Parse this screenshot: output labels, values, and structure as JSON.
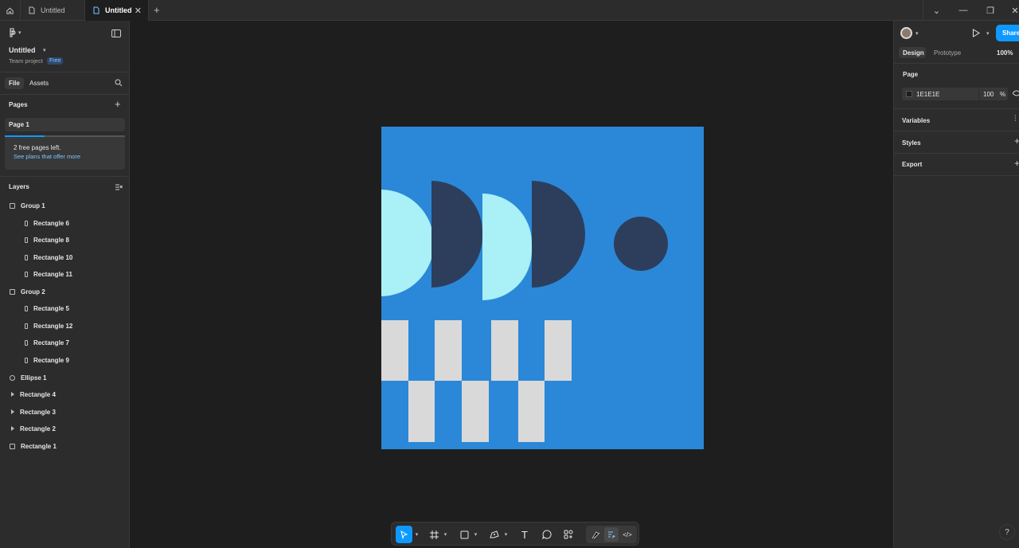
{
  "titlebar": {
    "tabs": [
      {
        "label": "Untitled"
      },
      {
        "label": "Untitled"
      }
    ]
  },
  "file": {
    "name": "Untitled",
    "project": "Team project",
    "plan_badge": "Free"
  },
  "left_tabs": {
    "file": "File",
    "assets": "Assets"
  },
  "pages": {
    "heading": "Pages",
    "items": [
      "Page 1"
    ],
    "upsell_title": "2 free pages left.",
    "upsell_link": "See plans that offer more"
  },
  "layers": {
    "heading": "Layers",
    "items": [
      {
        "name": "Group 1",
        "type": "group"
      },
      {
        "name": "Rectangle 6",
        "type": "rect"
      },
      {
        "name": "Rectangle 8",
        "type": "rect"
      },
      {
        "name": "Rectangle 10",
        "type": "rect"
      },
      {
        "name": "Rectangle 11",
        "type": "rect"
      },
      {
        "name": "Group 2",
        "type": "group"
      },
      {
        "name": "Rectangle 5",
        "type": "rect"
      },
      {
        "name": "Rectangle 12",
        "type": "rect"
      },
      {
        "name": "Rectangle 7",
        "type": "rect"
      },
      {
        "name": "Rectangle 9",
        "type": "rect"
      },
      {
        "name": "Ellipse 1",
        "type": "ellipse"
      },
      {
        "name": "Rectangle 4",
        "type": "vector"
      },
      {
        "name": "Rectangle 3",
        "type": "vector"
      },
      {
        "name": "Rectangle 2",
        "type": "vector"
      },
      {
        "name": "Rectangle 1",
        "type": "frame"
      }
    ]
  },
  "right_panel": {
    "share_label": "Share",
    "tabs": {
      "design": "Design",
      "prototype": "Prototype"
    },
    "zoom": "100%",
    "page_heading": "Page",
    "page_fill_hex": "1E1E1E",
    "page_fill_opacity": "100",
    "page_fill_unit": "%",
    "sections": [
      "Variables",
      "Styles",
      "Export"
    ]
  },
  "colors": {
    "accent": "#0d99ff",
    "artboard_bg": "#2b88d8",
    "shape_light": "#a9f0f7",
    "shape_dark": "#2d3e5c",
    "shape_grey": "#d9d9d9"
  },
  "help_label": "?"
}
